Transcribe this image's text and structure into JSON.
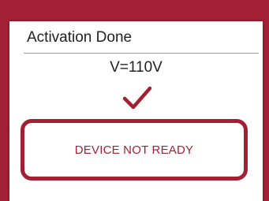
{
  "dialog": {
    "title": "Activation Done",
    "voltage_text": "V=110V",
    "status_text": "DEVICE NOT READY",
    "check_icon": "check-icon"
  },
  "colors": {
    "accent": "#a31f33",
    "text": "#212121",
    "divider": "#9e9e9e",
    "background": "#ffffff"
  }
}
